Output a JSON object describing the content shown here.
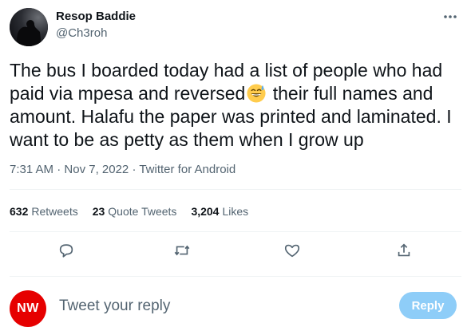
{
  "author": {
    "name": "Resop Baddie",
    "handle": "@Ch3roh"
  },
  "tweet": {
    "text_part1": "The bus I boarded today had a list of people who had paid via mpesa and reversed",
    "emoji": "grinning-sweat-emoji",
    "text_part2": " their full names and amount. Halafu the paper was printed and laminated. I want to be as petty as them when I grow up"
  },
  "meta": {
    "time": "7:31 AM",
    "sep1": " · ",
    "date": "Nov 7, 2022",
    "sep2": " · ",
    "source": "Twitter for Android"
  },
  "stats": {
    "retweets_count": "632",
    "retweets_label": "Retweets",
    "quotes_count": "23",
    "quotes_label": "Quote Tweets",
    "likes_count": "3,204",
    "likes_label": "Likes"
  },
  "actions": {
    "reply_icon": "speech-bubble-icon",
    "retweet_icon": "retweet-icon",
    "like_icon": "heart-icon",
    "share_icon": "share-icon"
  },
  "composer": {
    "avatar_text": "NW",
    "placeholder": "Tweet your reply",
    "reply_label": "Reply"
  },
  "colors": {
    "text": "#0f1419",
    "secondary": "#536471",
    "divider": "#eff3f4",
    "reply_button": "#8ecdf8",
    "nw_avatar": "#e60000"
  }
}
